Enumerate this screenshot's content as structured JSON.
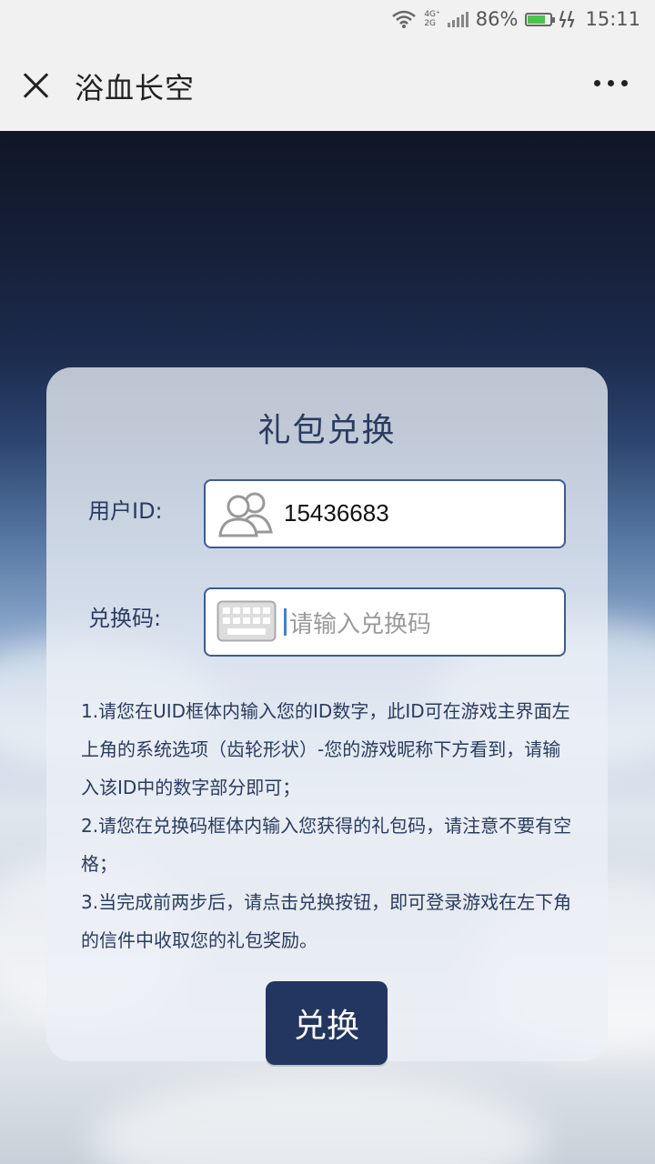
{
  "status_bar": {
    "network_top": "4G⁺",
    "network_bottom": "2G",
    "battery_percent": "86%",
    "battery_level": 0.86,
    "time": "15:11"
  },
  "title_bar": {
    "title": "浴血长空",
    "close_icon": "close-icon",
    "more_icon": "more-icon"
  },
  "card": {
    "title": "礼包兑换",
    "uid_label": "用户ID:",
    "uid_value": "15436683",
    "code_label": "兑换码:",
    "code_placeholder": "请输入兑换码",
    "instructions": [
      "1.请您在UID框体内输入您的ID数字，此ID可在游戏主界面左上角的系统选项（齿轮形状）-您的游戏昵称下方看到，请输入该ID中的数字部分即可；",
      "2.请您在兑换码框体内输入您获得的礼包码，请注意不要有空格；",
      "3.当完成前两步后，请点击兑换按钮，即可登录游戏在左下角的信件中收取您的礼包奖励。"
    ],
    "redeem_button": "兑换"
  },
  "colors": {
    "accent": "#223660",
    "text": "#2b3c60",
    "border": "#3d5b92",
    "battery": "#4cc24c"
  }
}
